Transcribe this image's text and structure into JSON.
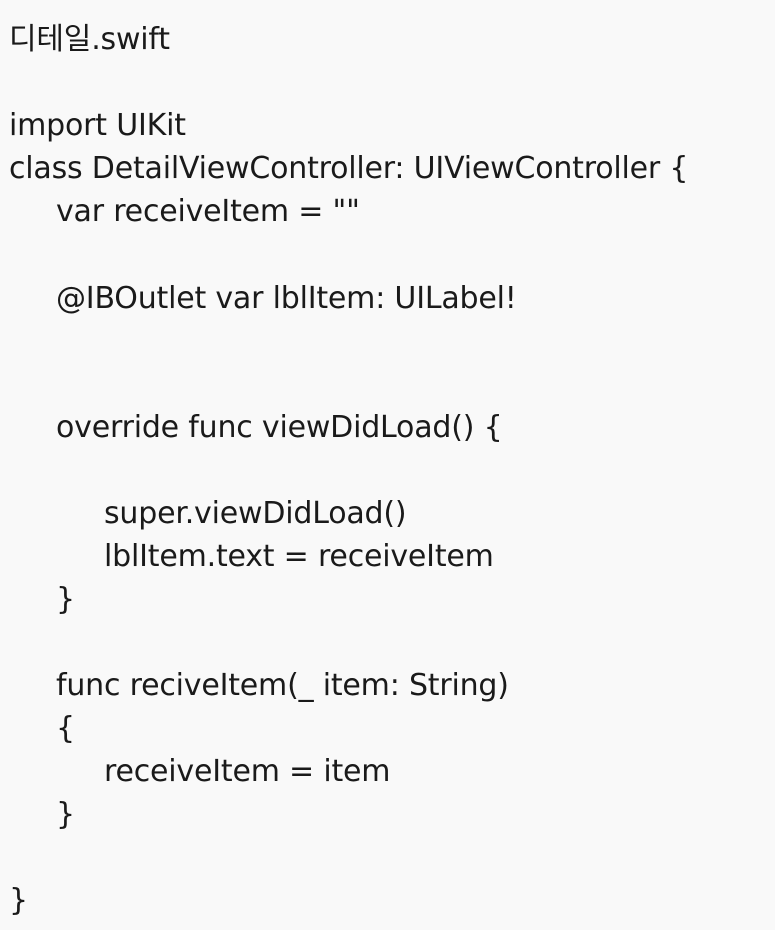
{
  "document": {
    "title": "디테일.swift",
    "lines": [
      "import UIKit",
      "class DetailViewController: UIViewController {",
      "var receiveItem = \"\"",
      "@IBOutlet var lblItem: UILabel!",
      "override func viewDidLoad() {",
      "super.viewDidLoad()",
      "lblItem.text = receiveItem",
      "}",
      "func reciveItem(_ item: String)",
      "{",
      "receiveItem = item",
      "}",
      "}"
    ]
  }
}
